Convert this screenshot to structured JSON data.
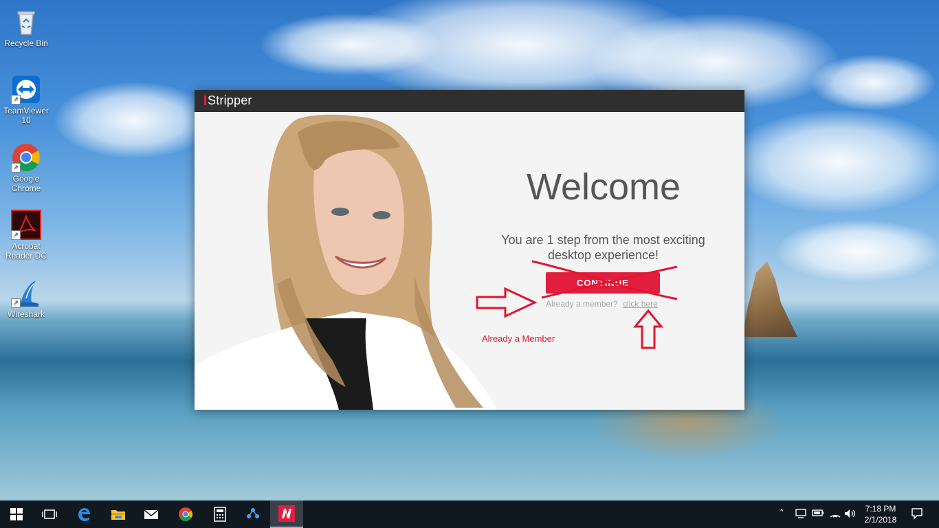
{
  "desktop": {
    "icons": [
      {
        "label": "Recycle Bin"
      },
      {
        "label": "TeamViewer 10"
      },
      {
        "label": "Google Chrome"
      },
      {
        "label": "Acrobat Reader DC"
      },
      {
        "label": "Wireshark"
      }
    ]
  },
  "window": {
    "app_title": "Stripper",
    "heading": "Welcome",
    "subtitle": "You are 1 step from the most exciting desktop experience!",
    "continue_label": "CONTINUE",
    "already_member": "Already a member?",
    "click_here": "click here"
  },
  "annotation": {
    "text": "Already a Member",
    "color": "#e0162e"
  },
  "taskbar": {
    "time": "7:18 PM",
    "date": "2/1/2018",
    "pinned": [
      "windows-start",
      "task-view",
      "edge",
      "file-explorer",
      "mail",
      "chrome",
      "calculator",
      "network-app",
      "istripper"
    ]
  },
  "colors": {
    "accent": "#e21e3f",
    "titlebar": "#2f2f2f",
    "taskbar": "#101820"
  }
}
